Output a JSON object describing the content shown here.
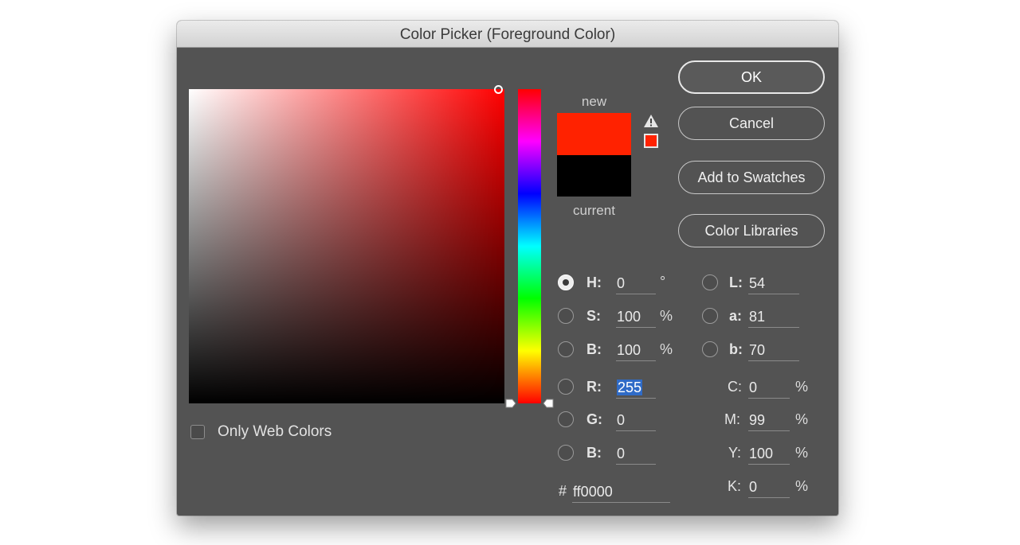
{
  "window": {
    "title": "Color Picker (Foreground Color)"
  },
  "colors": {
    "new": "#ff2200",
    "current": "#000000",
    "hue_base": "#ff0000"
  },
  "icons": {
    "gamut_warning": "warning-triangle-icon"
  },
  "picker": {
    "only_web_colors_label": "Only Web Colors",
    "only_web_colors_checked": false
  },
  "swatches": {
    "new_label": "new",
    "current_label": "current"
  },
  "buttons": {
    "ok": "OK",
    "cancel": "Cancel",
    "add_to_swatches": "Add to Swatches",
    "color_libraries": "Color Libraries"
  },
  "fields": {
    "h": {
      "label": "H:",
      "value": "0",
      "unit": "°"
    },
    "s": {
      "label": "S:",
      "value": "100",
      "unit": "%"
    },
    "b": {
      "label": "B:",
      "value": "100",
      "unit": "%"
    },
    "r": {
      "label": "R:",
      "value": "255"
    },
    "g": {
      "label": "G:",
      "value": "0"
    },
    "bl": {
      "label": "B:",
      "value": "0"
    },
    "l": {
      "label": "L:",
      "value": "54"
    },
    "a": {
      "label": "a:",
      "value": "81"
    },
    "lb": {
      "label": "b:",
      "value": "70"
    },
    "c": {
      "label": "C:",
      "value": "0",
      "unit": "%"
    },
    "m": {
      "label": "M:",
      "value": "99",
      "unit": "%"
    },
    "y": {
      "label": "Y:",
      "value": "100",
      "unit": "%"
    },
    "k": {
      "label": "K:",
      "value": "0",
      "unit": "%"
    },
    "hex": {
      "label": "#",
      "value": "ff0000"
    }
  }
}
